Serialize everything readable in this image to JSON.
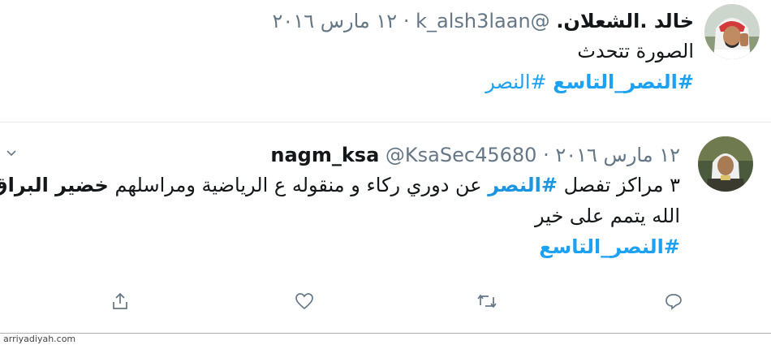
{
  "tweets": [
    {
      "display_name": "خالد .الشعلان.",
      "handle": "@k_alsh3laan",
      "date": "١٢ مارس ٢٠١٦",
      "separator": "·",
      "text_lines": [
        "الصورة تتحدث"
      ],
      "hashtags": [
        "#النصر_التاسع",
        "#النصر"
      ]
    },
    {
      "display_name": "nagm_ksa",
      "handle": "@KsaSec45680",
      "date": "١٢ مارس ٢٠١٦",
      "separator": "·",
      "line1_before": "٣ مراكز تفصل ",
      "line1_tag": "#النصر",
      "line1_mid": " عن دوري ركاء و منقوله ع الرياضية ومراسلهم ",
      "line1_bold": "خضير البراق",
      "line2": "الله يتمم على خير",
      "hashtag_line": "#النصر_التاسع"
    }
  ],
  "actions": [
    "reply-icon",
    "retweet-icon",
    "like-icon",
    "share-icon"
  ],
  "footer": {
    "source": "arriyadiyah.com"
  },
  "colors": {
    "link": "#1da1f2",
    "text": "#14171a",
    "muted": "#657786"
  }
}
